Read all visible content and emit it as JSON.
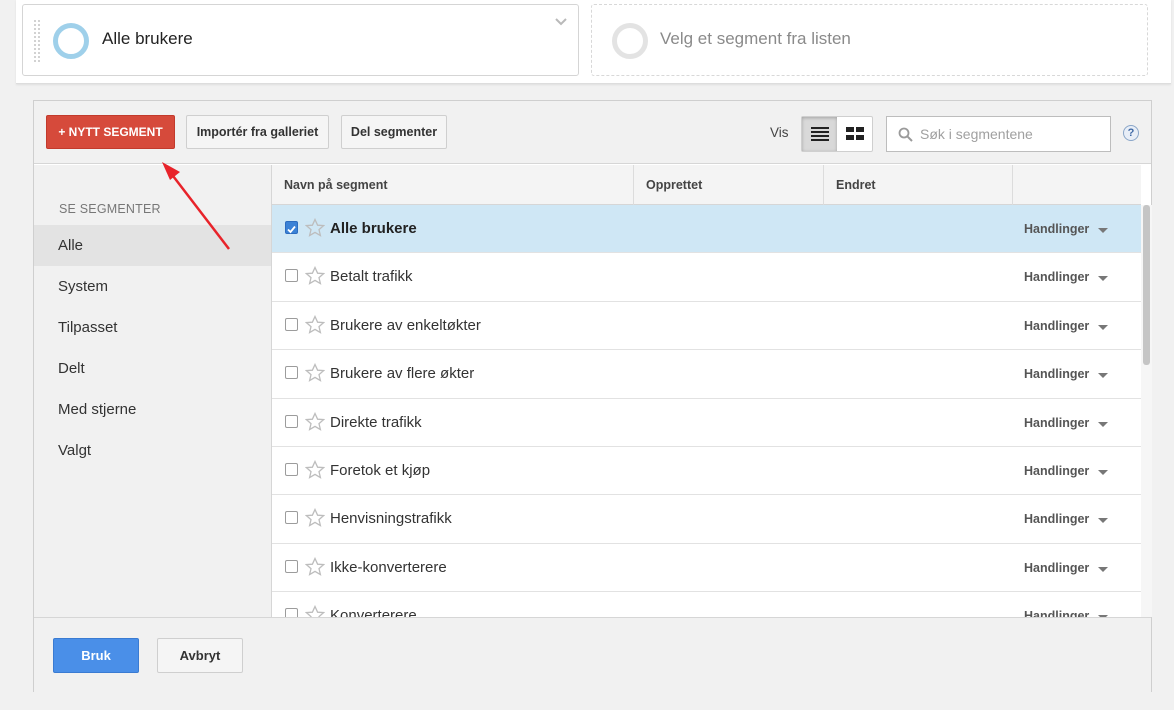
{
  "segments_bar": {
    "active_segment": "Alle brukere",
    "empty_slot_placeholder": "Velg et segment fra listen"
  },
  "toolbar": {
    "new_segment_label": "+ NYTT SEGMENT",
    "import_label": "Importér fra galleriet",
    "share_label": "Del segmenter",
    "view_label": "Vis",
    "view_mode": "list",
    "search_placeholder": "Søk i segmentene",
    "help_label": "?"
  },
  "sidebar": {
    "heading": "SE SEGMENTER",
    "items": [
      {
        "label": "Alle",
        "active": true
      },
      {
        "label": "System",
        "active": false
      },
      {
        "label": "Tilpasset",
        "active": false
      },
      {
        "label": "Delt",
        "active": false
      },
      {
        "label": "Med stjerne",
        "active": false
      },
      {
        "label": "Valgt",
        "active": false
      }
    ]
  },
  "table": {
    "columns": [
      "Navn på segment",
      "Opprettet",
      "Endret"
    ],
    "rows": [
      {
        "name": "Alle brukere",
        "checked": true,
        "actions": "Handlinger"
      },
      {
        "name": "Betalt trafikk",
        "checked": false,
        "actions": "Handlinger"
      },
      {
        "name": "Brukere av enkeltøkter",
        "checked": false,
        "actions": "Handlinger"
      },
      {
        "name": "Brukere av flere økter",
        "checked": false,
        "actions": "Handlinger"
      },
      {
        "name": "Direkte trafikk",
        "checked": false,
        "actions": "Handlinger"
      },
      {
        "name": "Foretok et kjøp",
        "checked": false,
        "actions": "Handlinger"
      },
      {
        "name": "Henvisningstrafikk",
        "checked": false,
        "actions": "Handlinger"
      },
      {
        "name": "Ikke-konverterere",
        "checked": false,
        "actions": "Handlinger"
      },
      {
        "name": "Konverterere",
        "checked": false,
        "actions": "Handlinger"
      }
    ]
  },
  "footer": {
    "apply_label": "Bruk",
    "cancel_label": "Avbryt"
  },
  "colors": {
    "new_segment_red": "#d64a3b",
    "apply_blue": "#4a8fe8",
    "selected_row": "#cfe7f5",
    "annotation_arrow": "#e8232a"
  }
}
